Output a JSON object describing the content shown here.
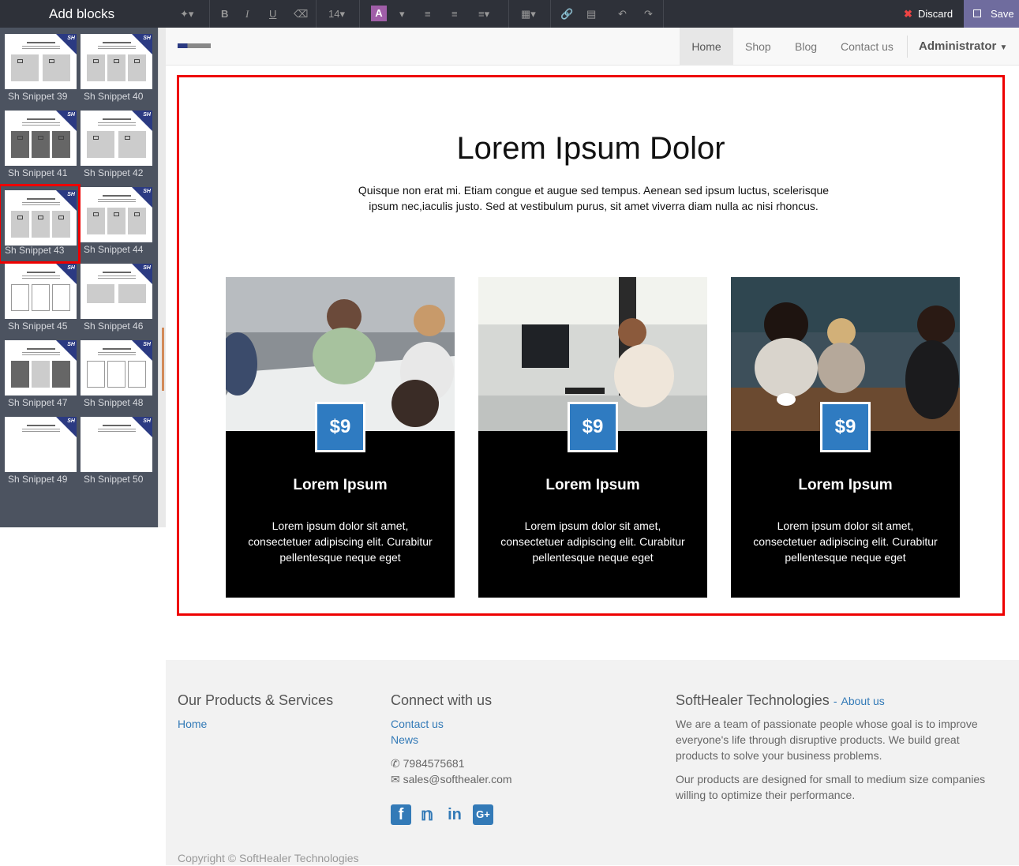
{
  "sidebar": {
    "title": "Add blocks",
    "snippets": [
      {
        "label": "Sh Snippet 39"
      },
      {
        "label": "Sh Snippet 40"
      },
      {
        "label": "Sh Snippet 41"
      },
      {
        "label": "Sh Snippet 42"
      },
      {
        "label": "Sh Snippet 43",
        "selected": true
      },
      {
        "label": "Sh Snippet 44"
      },
      {
        "label": "Sh Snippet 45"
      },
      {
        "label": "Sh Snippet 46"
      },
      {
        "label": "Sh Snippet 47"
      },
      {
        "label": "Sh Snippet 48"
      },
      {
        "label": "Sh Snippet 49"
      },
      {
        "label": "Sh Snippet 50"
      }
    ]
  },
  "toolbar": {
    "font_size": "14",
    "discard_label": "Discard",
    "save_label": "Save",
    "icons": [
      "magic-wand-icon",
      "bold-icon",
      "italic-icon",
      "underline-icon",
      "eraser-icon",
      "font-size-select",
      "font-color-icon",
      "list-ul-icon",
      "list-ol-icon",
      "align-icon",
      "table-icon",
      "link-icon",
      "image-icon",
      "undo-icon",
      "redo-icon"
    ]
  },
  "nav": {
    "items": [
      "Home",
      "Shop",
      "Blog",
      "Contact us"
    ],
    "active": "Home",
    "user": "Administrator"
  },
  "hero": {
    "title": "Lorem Ipsum Dolor",
    "lead": "Quisque non erat mi. Etiam congue et augue sed tempus. Aenean sed ipsum luctus, scelerisque ipsum nec,iaculis justo. Sed at vestibulum purus, sit amet viverra diam nulla ac nisi rhoncus."
  },
  "cards": [
    {
      "price": "$9",
      "title": "Lorem Ipsum",
      "text": "Lorem ipsum dolor sit amet, consectetuer adipiscing elit. Curabitur pellentesque neque eget"
    },
    {
      "price": "$9",
      "title": "Lorem Ipsum",
      "text": "Lorem ipsum dolor sit amet, consectetuer adipiscing elit. Curabitur pellentesque neque eget"
    },
    {
      "price": "$9",
      "title": "Lorem Ipsum",
      "text": "Lorem ipsum dolor sit amet, consectetuer adipiscing elit. Curabitur pellentesque neque eget"
    }
  ],
  "footer": {
    "col1_title": "Our Products & Services",
    "col1_links": [
      "Home"
    ],
    "col2_title": "Connect with us",
    "col2_links": [
      "Contact us",
      "News"
    ],
    "phone": "7984575681",
    "email": "sales@softhealer.com",
    "col3_title": "SoftHealer Technologies",
    "col3_sep": "-",
    "col3_link": "About us",
    "about_p1": "We are a team of passionate people whose goal is to improve everyone's life through disruptive products. We build great products to solve your business problems.",
    "about_p2": "Our products are designed for small to medium size companies willing to optimize their performance.",
    "copyright": "Copyright © SoftHealer Technologies"
  },
  "colors": {
    "accent": "#2f7bc1",
    "selection": "#e00000",
    "toolbar_bg": "#2e3139",
    "sidebar_bg": "#4c5360",
    "save_bg": "#6f6c9e"
  }
}
